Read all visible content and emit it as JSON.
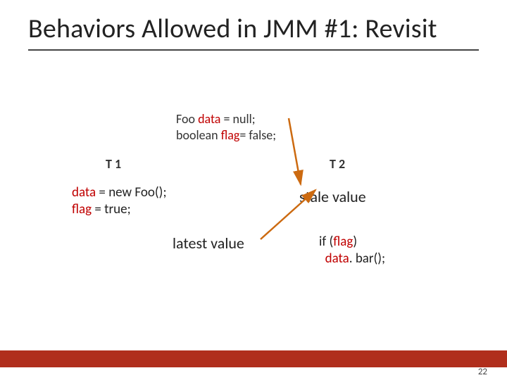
{
  "title": "Behaviors Allowed in JMM #1: Revisit",
  "shared": {
    "line1_pre": "Foo ",
    "line1_kw": "data",
    "line1_post": " = null;",
    "line2_pre": "boolean ",
    "line2_kw": "flag",
    "line2_post": "= false;"
  },
  "threads": {
    "t1_label": "T 1",
    "t2_label": "T 2"
  },
  "t1": {
    "line1_kw": "data",
    "line1_rest": " = new Foo();",
    "line2_kw": "flag",
    "line2_rest": " = true;"
  },
  "labels": {
    "stale": "stale value",
    "latest": "latest value"
  },
  "t2": {
    "line1_pre": "if (",
    "line1_kw": "flag",
    "line1_post": ")",
    "line2_pre": "  ",
    "line2_kw": "data",
    "line2_post": ". bar();"
  },
  "page_number": "22",
  "colors": {
    "keyword": "#c00000",
    "bar": "#b02e1c",
    "arrow": "#cc6a10"
  }
}
